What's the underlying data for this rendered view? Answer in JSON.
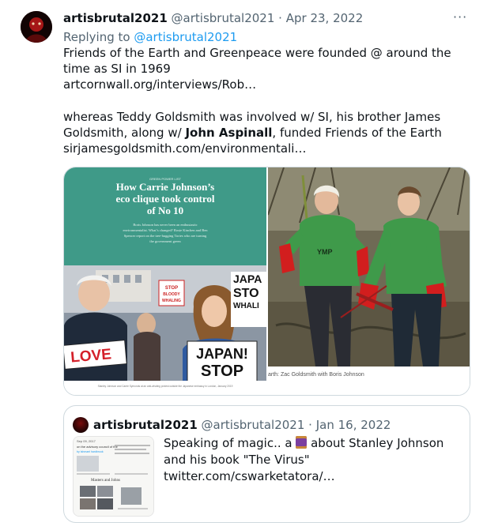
{
  "tweet": {
    "display_name": "artisbrutal2021",
    "handle": "@artisbrutal2021",
    "separator": "·",
    "date": "Apr 23, 2022",
    "more_label": "···",
    "replying_prefix": "Replying to",
    "replying_handle": "@artisbrutal2021",
    "para1": "Friends of the Earth and Greenpeace were founded @ around the time as SI in 1969",
    "link1": "artcornwall.org/interviews/Rob…",
    "para2_pre": "whereas Teddy Goldsmith was involved w/ SI, his brother James Goldsmith, along w/ ",
    "para2_bold": "John Aspinall",
    "para2_post": ", funded Friends of the Earth",
    "link2": "sirjamesgoldsmith.com/environmentali…"
  },
  "media": {
    "left": {
      "kicker": "GREEN POWER LIST",
      "headline": "How Carrie Johnson’s eco clique took control of No 10",
      "standfirst": "Boris Johnson has never been an enthusiastic environmentalist. What’s changed? Rosie Kinchen and Ben Spencer report on the tree-hugging Tories who are turning the government green",
      "sign1": "LOVE",
      "sign2_l1": "JAPAN!",
      "sign2_l2": "STOP",
      "sign3_l1": "JAPA",
      "sign3_l2": "STO",
      "sign3_l3": "WHALI",
      "sign4_l1": "STOP",
      "sign4_l2": "BLOODY",
      "sign4_l3": "WHALING",
      "caption": "Stanley Johnson and Carrie Symonds at an anti-whaling protest outside the Japanese embassy in London, January 2019"
    },
    "right": {
      "caption": "arth: Zac Goldsmith with Boris Johnson",
      "tshirt": "YMP"
    }
  },
  "quote": {
    "display_name": "artisbrutal2021",
    "handle": "@artisbrutal2021",
    "separator": "·",
    "date": "Jan 16, 2022",
    "text_pre": "Speaking of magic.. a ",
    "text_post": " about Stanley Johnson and his book \"The Virus\"  twitter.com/cswarketatora/…",
    "thumb_title": "Masters and Johns",
    "thumb_top": "Sep 09, 2017",
    "thumb_sub": "on the advisory council of the",
    "thumb_sub2": "by Ishmael hardbrook"
  },
  "colors": {
    "link": "#1d9bf0",
    "text": "#0f1419",
    "muted": "#536471",
    "border": "#cfd9de",
    "teal": "#3f9a88"
  }
}
